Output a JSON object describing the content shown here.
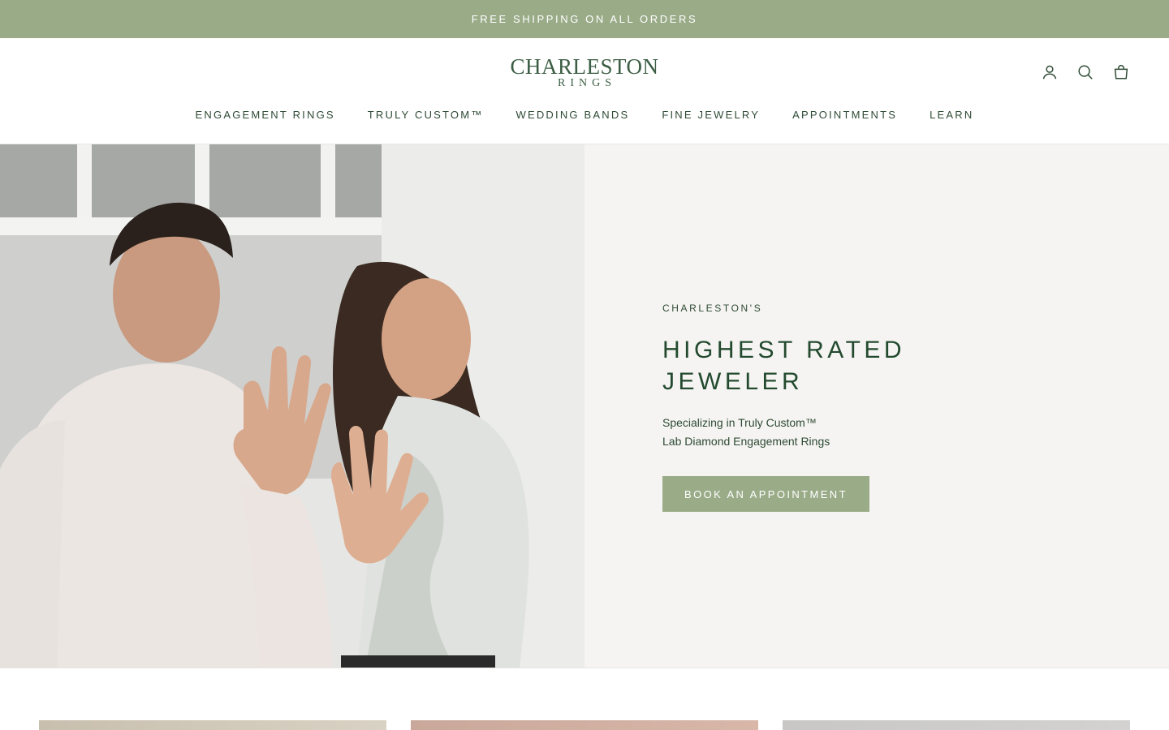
{
  "announcement": {
    "text": "FREE SHIPPING ON ALL ORDERS"
  },
  "brand": {
    "line1": "CHARLESTON",
    "line2": "RINGS"
  },
  "header_icons": [
    "account-icon",
    "search-icon",
    "cart-icon"
  ],
  "nav": {
    "items": [
      {
        "label": "ENGAGEMENT RINGS"
      },
      {
        "label": "TRULY CUSTOM™"
      },
      {
        "label": "WEDDING BANDS"
      },
      {
        "label": "FINE JEWELRY"
      },
      {
        "label": "APPOINTMENTS"
      },
      {
        "label": "LEARN"
      }
    ]
  },
  "hero": {
    "eyebrow": "CHARLESTON'S",
    "title_line1": "HIGHEST RATED",
    "title_line2": "JEWELER",
    "subtitle_line1": "Specializing in Truly Custom™",
    "subtitle_line2": "Lab Diamond Engagement Rings",
    "cta_label": "BOOK AN APPOINTMENT",
    "image_alt": "couple showing engagement ring and wedding band"
  },
  "colors": {
    "accent": "#9aab88",
    "text": "#2e4a34",
    "panel_bg": "#f5f4f2"
  }
}
